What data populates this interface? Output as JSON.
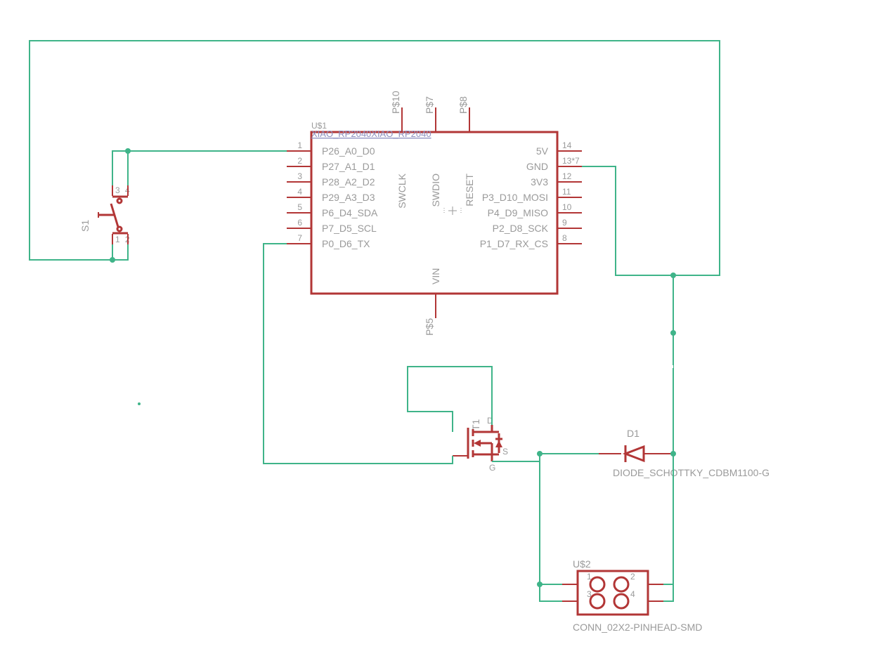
{
  "u1": {
    "ref": "U$1",
    "name": "XIAO_RP2040XIAO_RP2040",
    "left_pins": [
      {
        "num": "1",
        "label": "P26_A0_D0"
      },
      {
        "num": "2",
        "label": "P27_A1_D1"
      },
      {
        "num": "3",
        "label": "P28_A2_D2"
      },
      {
        "num": "4",
        "label": "P29_A3_D3"
      },
      {
        "num": "5",
        "label": "P6_D4_SDA"
      },
      {
        "num": "6",
        "label": "P7_D5_SCL"
      },
      {
        "num": "7",
        "label": "P0_D6_TX"
      }
    ],
    "right_pins": [
      {
        "num": "14",
        "label": "5V"
      },
      {
        "num": "13*7",
        "label": "GND"
      },
      {
        "num": "12",
        "label": "3V3"
      },
      {
        "num": "11",
        "label": "P3_D10_MOSI"
      },
      {
        "num": "10",
        "label": "P4_D9_MISO"
      },
      {
        "num": "9",
        "label": "P2_D8_SCK"
      },
      {
        "num": "8",
        "label": "P1_D7_RX_CS"
      }
    ],
    "top_pins": [
      {
        "num": "P$10",
        "label": "SWCLK"
      },
      {
        "num": "P$7",
        "label": "SWDIO"
      },
      {
        "num": "P$8",
        "label": "RESET"
      }
    ],
    "bottom_pins": [
      {
        "num": "P$5",
        "label": "VIN"
      }
    ]
  },
  "s1": {
    "ref": "S1",
    "pins": [
      "1",
      "2",
      "3",
      "4"
    ]
  },
  "t1": {
    "ref": "T1"
  },
  "d1": {
    "ref": "D1",
    "name": "DIODE_SCHOTTKY_CDBM1100-G"
  },
  "u2": {
    "ref": "U$2",
    "name": "CONN_02X2-PINHEAD-SMD",
    "pins": [
      "1",
      "2",
      "3",
      "4"
    ]
  }
}
